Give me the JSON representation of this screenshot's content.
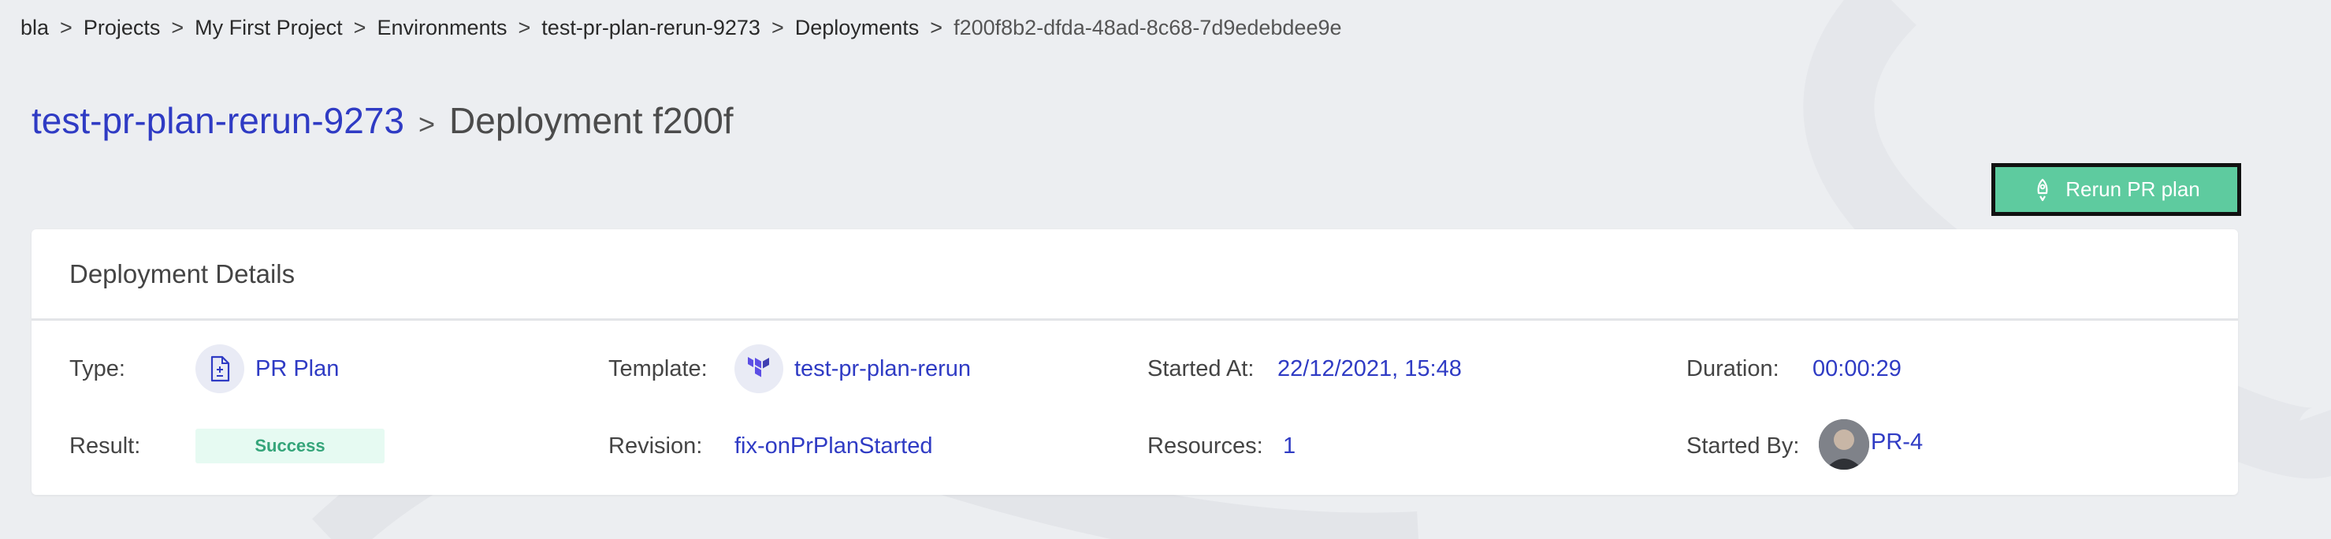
{
  "breadcrumb": {
    "items": [
      "bla",
      "Projects",
      "My First Project",
      "Environments",
      "test-pr-plan-rerun-9273",
      "Deployments",
      "f200f8b2-dfda-48ad-8c68-7d9edebdee9e"
    ],
    "separator": ">"
  },
  "title": {
    "environment": "test-pr-plan-rerun-9273",
    "separator": ">",
    "deployment": "Deployment f200f"
  },
  "actions": {
    "rerun_label": "Rerun PR plan"
  },
  "card": {
    "header": "Deployment Details",
    "type": {
      "label": "Type:",
      "value": "PR Plan",
      "icon": "document-icon"
    },
    "template": {
      "label": "Template:",
      "value": "test-pr-plan-rerun",
      "icon": "terraform-icon"
    },
    "started_at": {
      "label": "Started At:",
      "value": "22/12/2021, 15:48"
    },
    "duration": {
      "label": "Duration:",
      "value": "00:00:29"
    },
    "result": {
      "label": "Result:",
      "value": "Success"
    },
    "revision": {
      "label": "Revision:",
      "value": "fix-onPrPlanStarted"
    },
    "resources": {
      "label": "Resources:",
      "value": "1"
    },
    "started_by": {
      "label": "Started By:",
      "value": "PR-4"
    }
  },
  "colors": {
    "link": "#2f3bc4",
    "button": "#5ecb9f",
    "success_bg": "#e6faf2",
    "success_text": "#35a57a"
  }
}
